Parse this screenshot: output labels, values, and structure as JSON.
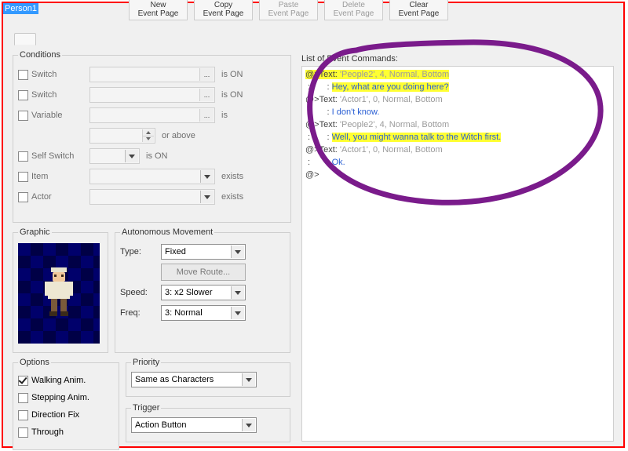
{
  "title_input": "Person1",
  "toolbar": [
    {
      "l1": "New",
      "l2": "Event Page",
      "enabled": true
    },
    {
      "l1": "Copy",
      "l2": "Event Page",
      "enabled": true
    },
    {
      "l1": "Paste",
      "l2": "Event Page",
      "enabled": false
    },
    {
      "l1": "Delete",
      "l2": "Event Page",
      "enabled": false
    },
    {
      "l1": "Clear",
      "l2": "Event Page",
      "enabled": true
    }
  ],
  "groups": {
    "conditions": "Conditions",
    "graphic": "Graphic",
    "automove": "Autonomous Movement",
    "options": "Options",
    "priority": "Priority",
    "trigger": "Trigger"
  },
  "conditions": {
    "switch": "Switch",
    "variable": "Variable",
    "self_switch": "Self Switch",
    "item": "Item",
    "actor": "Actor",
    "is_on": "is ON",
    "is": "is",
    "or_above": "or above",
    "exists": "exists"
  },
  "automove": {
    "type_label": "Type:",
    "type_value": "Fixed",
    "move_route": "Move Route...",
    "speed_label": "Speed:",
    "speed_value": "3: x2 Slower",
    "freq_label": "Freq:",
    "freq_value": "3: Normal"
  },
  "options": {
    "walking": "Walking Anim.",
    "stepping": "Stepping Anim.",
    "direction_fix": "Direction Fix",
    "through": "Through"
  },
  "priority_value": "Same as Characters",
  "trigger_value": "Action Button",
  "cmd_label": "List of Event Commands:",
  "commands": [
    {
      "type": "head",
      "text": "'People2', 4, Normal, Bottom",
      "hl": true
    },
    {
      "type": "body",
      "text": "Hey, what are you doing here?",
      "hl": true
    },
    {
      "type": "head",
      "text": "'Actor1', 0, Normal, Bottom",
      "hl": false
    },
    {
      "type": "body",
      "text": "I don't know.",
      "hl": false
    },
    {
      "type": "head",
      "text": "'People2', 4, Normal, Bottom",
      "hl": false
    },
    {
      "type": "body",
      "text": "Well, you might wanna talk to the Witch first.",
      "hl": true
    },
    {
      "type": "head",
      "text": "'Actor1', 0, Normal, Bottom",
      "hl": false
    },
    {
      "type": "body",
      "text": "Ok.",
      "hl": false
    }
  ],
  "cmd_prefix_head": "@>Text: ",
  "cmd_prefix_body": " :       : ",
  "cmd_end": "@>"
}
